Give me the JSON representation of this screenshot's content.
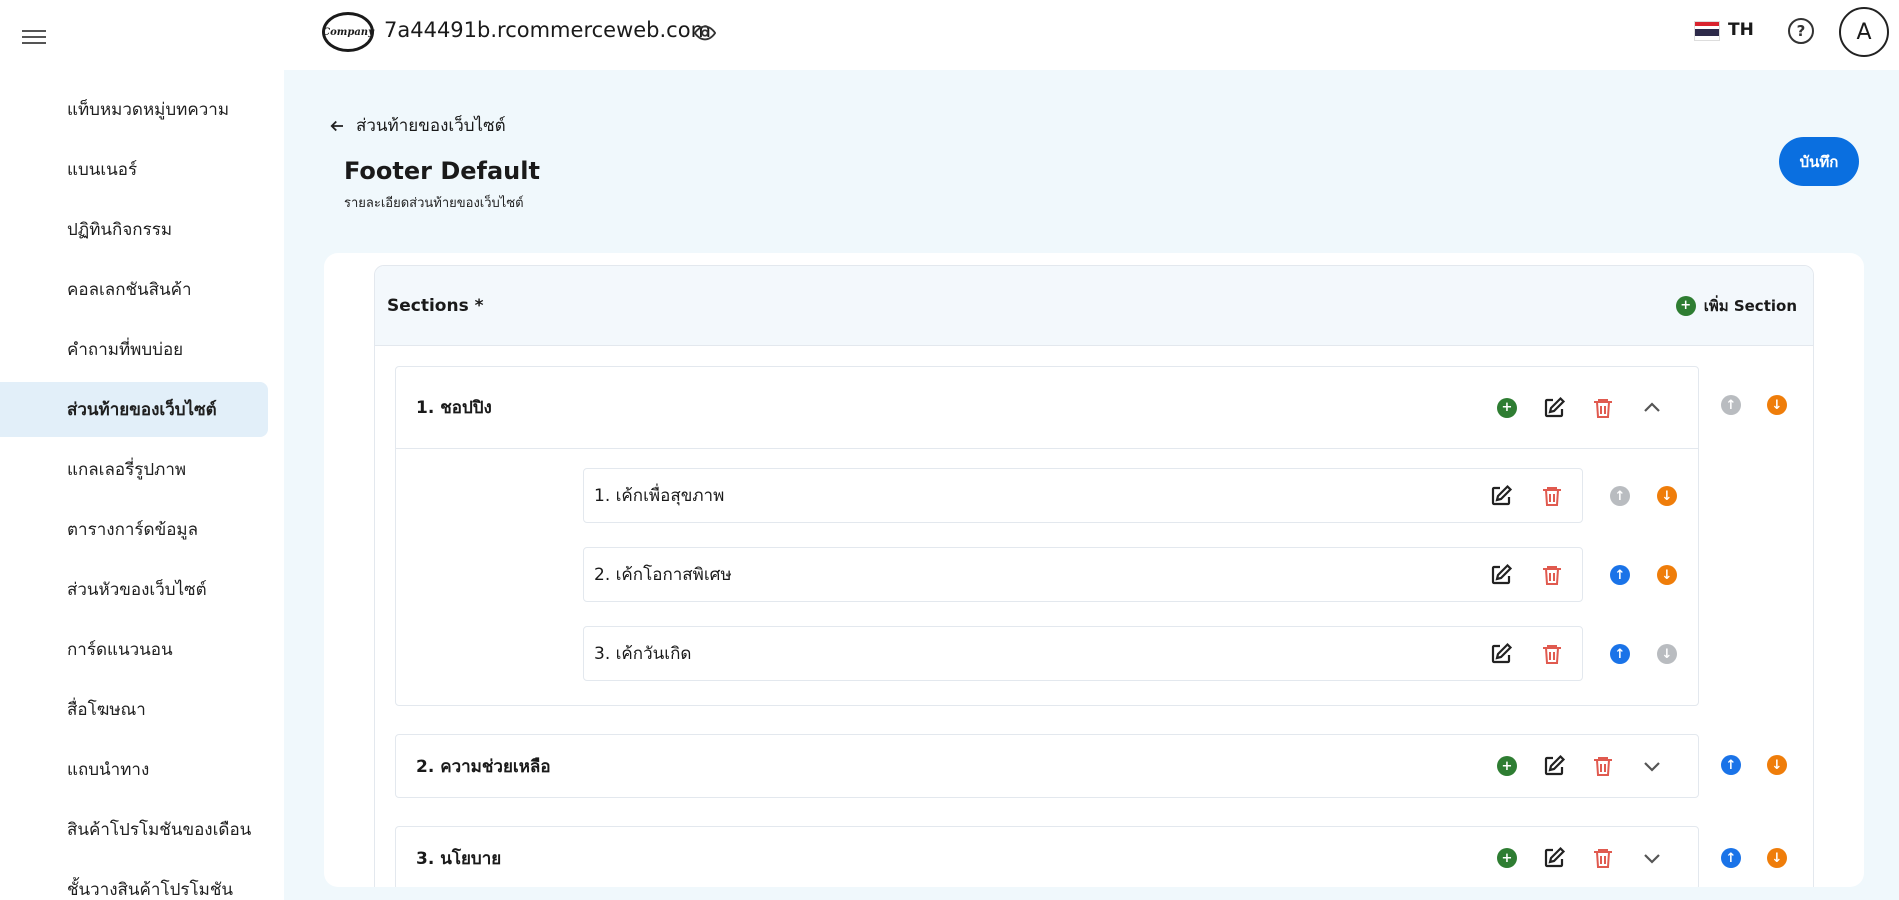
{
  "header": {
    "domain": "7a44491b.rcommerceweb.com",
    "logo_text": "Company",
    "lang": "TH",
    "avatar": "A",
    "help": "?"
  },
  "sidebar": {
    "items": [
      {
        "label": "แท็บหมวดหมู่บทความ",
        "active": false
      },
      {
        "label": "แบนเนอร์",
        "active": false
      },
      {
        "label": "ปฏิทินกิจกรรม",
        "active": false
      },
      {
        "label": "คอลเลกชันสินค้า",
        "active": false
      },
      {
        "label": "คำถามที่พบบ่อย",
        "active": false
      },
      {
        "label": "ส่วนท้ายของเว็บไซต์",
        "active": true
      },
      {
        "label": "แกลเลอรี่รูปภาพ",
        "active": false
      },
      {
        "label": "ตารางการ์ดข้อมูล",
        "active": false
      },
      {
        "label": "ส่วนหัวของเว็บไซต์",
        "active": false
      },
      {
        "label": "การ์ดแนวนอน",
        "active": false
      },
      {
        "label": "สื่อโฆษณา",
        "active": false
      },
      {
        "label": "แถบนำทาง",
        "active": false
      },
      {
        "label": "สินค้าโปรโมชันของเดือน",
        "active": false
      },
      {
        "label": "ชั้นวางสินค้าโปรโมชัน",
        "active": false
      }
    ]
  },
  "page": {
    "back_label": "ส่วนท้ายของเว็บไซต์",
    "title": "Footer Default",
    "subtitle": "รายละเอียดส่วนท้ายของเว็บไซต์",
    "save_label": "บันทึก"
  },
  "sections": {
    "title": "Sections *",
    "add_label": "เพิ่ม Section",
    "groups": [
      {
        "title": "1. ชอปปิง",
        "expanded": true,
        "up_enabled": false,
        "down_enabled": true,
        "items": [
          {
            "label": "1. เค้กเพื่อสุขภาพ",
            "up_enabled": false,
            "down_enabled": true
          },
          {
            "label": "2. เค้กโอกาสพิเศษ",
            "up_enabled": true,
            "down_enabled": true
          },
          {
            "label": "3. เค้กวันเกิด",
            "up_enabled": true,
            "down_enabled": false
          }
        ]
      },
      {
        "title": "2. ความช่วยเหลือ",
        "expanded": false,
        "up_enabled": true,
        "down_enabled": true,
        "items": []
      },
      {
        "title": "3. นโยบาย",
        "expanded": false,
        "up_enabled": true,
        "down_enabled": true,
        "items": []
      }
    ]
  },
  "colors": {
    "primary": "#0a6fe0",
    "add_green": "#2e7d32",
    "delete_red": "#e05a4f",
    "up_blue": "#1a73e8",
    "down_orange": "#ef7d0a",
    "disabled_gray": "#b9bcc0",
    "active_nav_bg": "#e2eff9"
  }
}
